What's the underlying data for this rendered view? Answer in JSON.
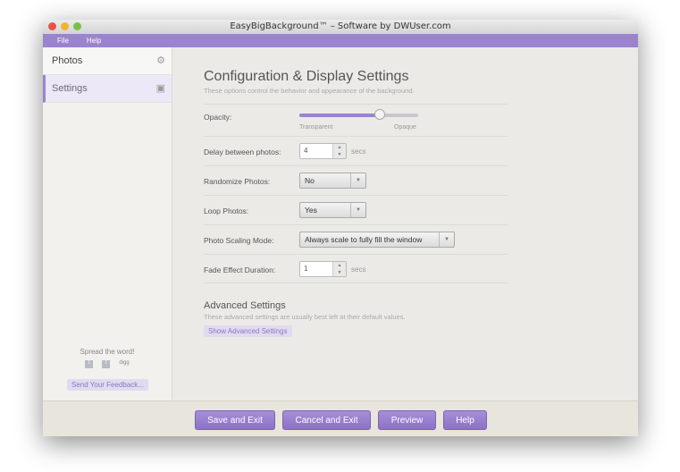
{
  "window": {
    "title": "EasyBigBackground™ – Software by DWUser.com"
  },
  "menu": [
    "File",
    "Help"
  ],
  "sidebar": {
    "items": [
      {
        "label": "Photos",
        "icon": "gear-icon"
      },
      {
        "label": "Settings",
        "icon": "image-icon"
      }
    ],
    "spread": "Spread the word!",
    "social": [
      "twitter-icon",
      "facebook-icon",
      "digg"
    ],
    "feedback": "Send Your Feedback..."
  },
  "main": {
    "title": "Configuration & Display Settings",
    "subtitle": "These options control the behavior and appearance of the background.",
    "opacity": {
      "label": "Opacity:",
      "value_percent": 68,
      "min_label": "Transparent",
      "max_label": "Opaque"
    },
    "delay": {
      "label": "Delay between photos:",
      "value": "4",
      "unit": "secs"
    },
    "randomize": {
      "label": "Randomize Photos:",
      "value": "No"
    },
    "loop": {
      "label": "Loop Photos:",
      "value": "Yes"
    },
    "scaling": {
      "label": "Photo Scaling Mode:",
      "value": "Always scale to fully fill the window"
    },
    "fade": {
      "label": "Fade Effect Duration:",
      "value": "1",
      "unit": "secs"
    },
    "advanced": {
      "title": "Advanced Settings",
      "subtitle": "These advanced settings are usually best left at their default values.",
      "button": "Show Advanced Settings"
    }
  },
  "footer": {
    "save": "Save and Exit",
    "cancel": "Cancel and Exit",
    "preview": "Preview",
    "help": "Help"
  },
  "colors": {
    "accent": "#9b83cf"
  }
}
